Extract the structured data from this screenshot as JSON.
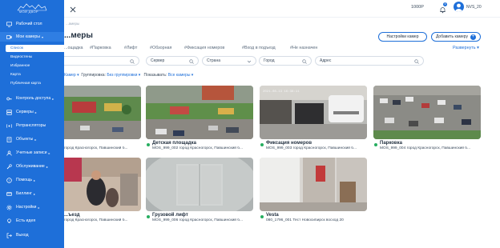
{
  "app": {
    "logo_text": "МОЙ ДВОР",
    "balance": "1000Р",
    "notifications_count": "5",
    "user_name": "NVS_20",
    "accent_color": "#1e6fd9",
    "online_color": "#27ae60"
  },
  "sidebar": {
    "items": [
      {
        "label": "Рабочий стол",
        "icon": "desktop-icon",
        "caret": ""
      },
      {
        "label": "Мои камеры",
        "icon": "camera-icon",
        "caret": "▾"
      },
      {
        "label": "Контроль доступа",
        "icon": "key-icon",
        "caret": "▸"
      },
      {
        "label": "Серверы",
        "icon": "server-icon",
        "caret": "▸"
      },
      {
        "label": "Ретрансляторы",
        "icon": "relay-icon",
        "caret": ""
      },
      {
        "label": "Объекты",
        "icon": "building-icon",
        "caret": "▸"
      },
      {
        "label": "Учетные записи",
        "icon": "users-icon",
        "caret": "▸"
      },
      {
        "label": "Обслуживание",
        "icon": "wrench-icon",
        "caret": "▸"
      },
      {
        "label": "Помощь",
        "icon": "help-icon",
        "caret": "▸"
      },
      {
        "label": "Биллинг",
        "icon": "billing-icon",
        "caret": "▸"
      },
      {
        "label": "Настройки",
        "icon": "gear-icon",
        "caret": "▸"
      },
      {
        "label": "Есть идея",
        "icon": "lightbulb-icon",
        "caret": ""
      },
      {
        "label": "Выход",
        "icon": "logout-icon",
        "caret": ""
      }
    ],
    "subitems": [
      {
        "label": "Список",
        "active": true
      },
      {
        "label": "Видеостены",
        "active": false
      },
      {
        "label": "Избранное",
        "active": false
      },
      {
        "label": "Карта",
        "active": false
      },
      {
        "label": "Публичная карта",
        "active": false
      }
    ]
  },
  "header": {
    "breadcrumb": "...амеры",
    "title": "...меры",
    "settings_button": "Настройки камер",
    "add_button": "Добавить камеру"
  },
  "tags": [
    "...ощадка",
    "#Парковка",
    "#Лифт",
    "#Обзорная",
    "#Фиксация номеров",
    "#Вход в подъезд",
    "#Не назначен"
  ],
  "sort_label": "Развернуть",
  "filters": {
    "search_placeholder": "",
    "server_placeholder": "Сервер",
    "country_placeholder": "Страна",
    "city_placeholder": "Город",
    "address_placeholder": "Адрес"
  },
  "toolbar": {
    "cameras_link": "Камер",
    "grouping_label": "Группировка:",
    "grouping_value": "Без группировки",
    "show_label": "Показывать:",
    "show_value": "Все камеры"
  },
  "cameras": [
    {
      "title": "",
      "subtitle": "город Красногорск, Павшинский б...",
      "online": true
    },
    {
      "title": "Детская площадка",
      "subtitle": "MOS_999_002 город Красногорск, Павшинский б...",
      "online": true
    },
    {
      "title": "Фиксация номеров",
      "subtitle": "MOS_999_003 город Красногорск, Павшинский б...",
      "online": true
    },
    {
      "title": "Парковка",
      "subtitle": "MOS_999_004 город Красногорск, Павшинский б...",
      "online": true
    },
    {
      "title": "...ъезд",
      "subtitle": "город Красногорск, Павшинский б...",
      "online": true
    },
    {
      "title": "Грузовой лифт",
      "subtitle": "MOS_999_006 город Красногорск, Павшинский б...",
      "online": true
    },
    {
      "title": "Vesta",
      "subtitle": "080_1796_001 Тест Новосибирск восход 20",
      "online": true
    }
  ]
}
